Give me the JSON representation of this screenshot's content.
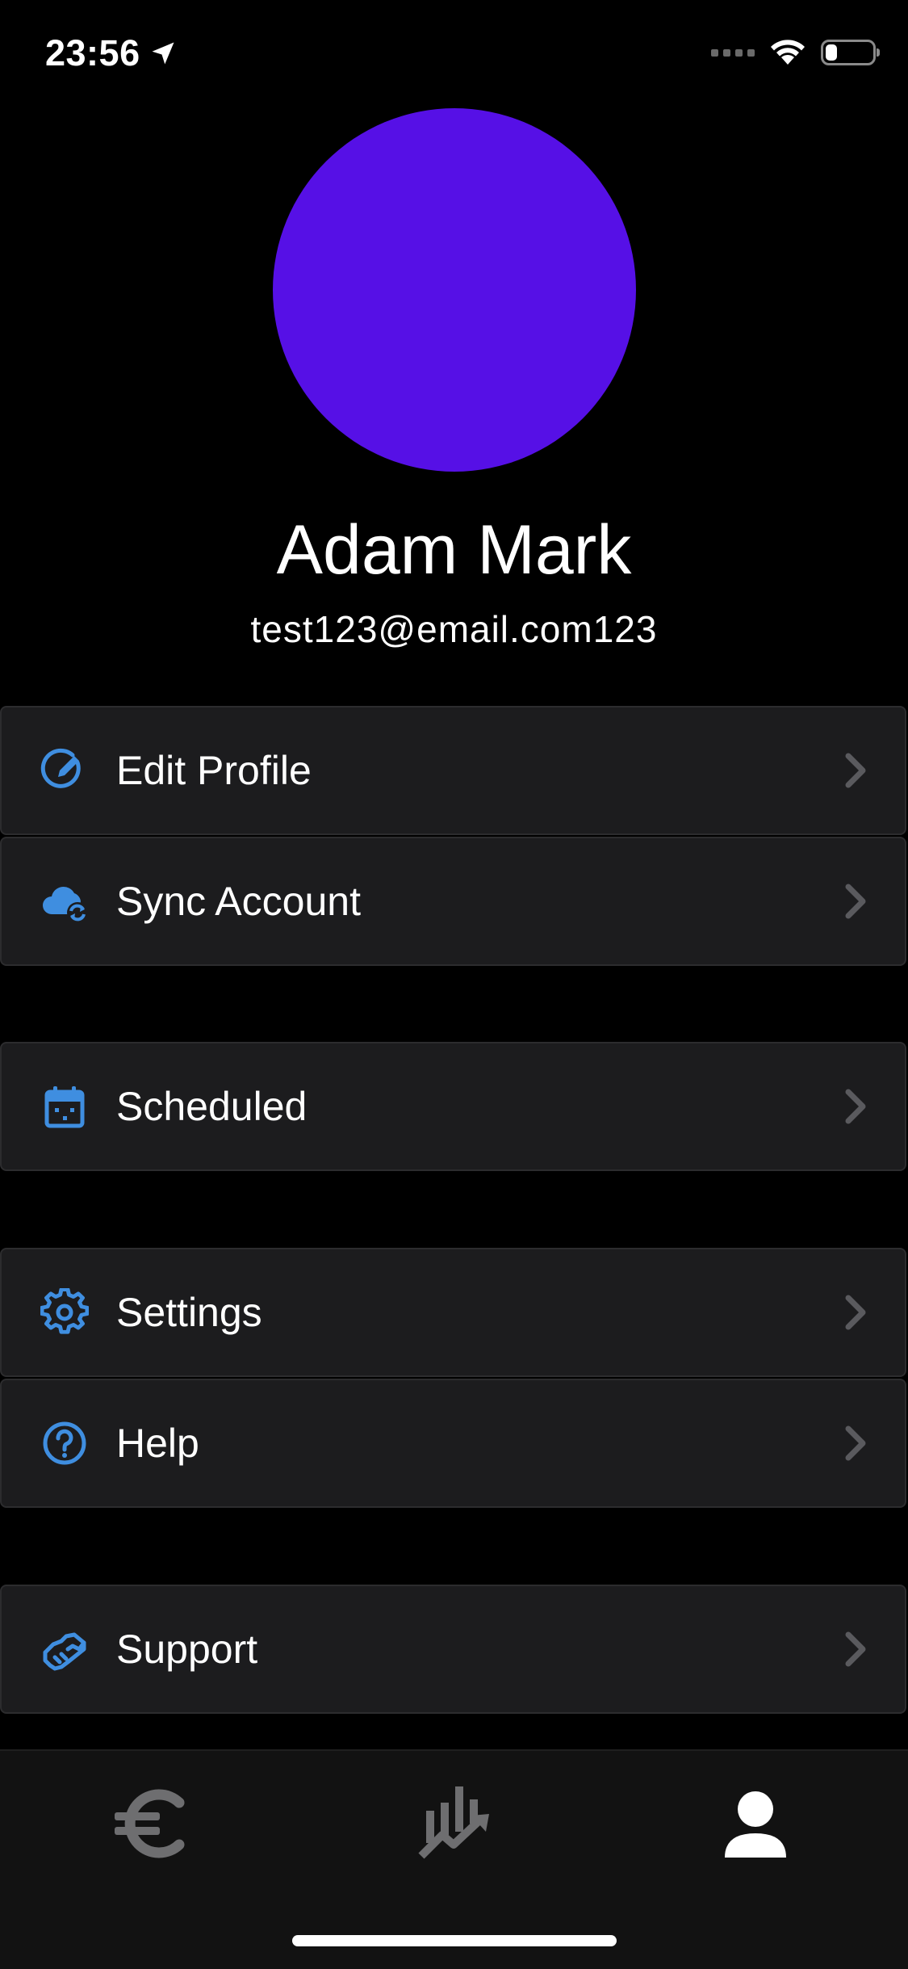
{
  "status_bar": {
    "time": "23:56",
    "battery_level": 0.25
  },
  "profile": {
    "name": "Adam Mark",
    "email": "test123@email.com123",
    "avatar_color": "#5610e6"
  },
  "theme": {
    "accent": "#3f8ee0",
    "chevron": "#5a5a5e",
    "row_bg": "#1c1c1e"
  },
  "menu": {
    "edit_profile": {
      "label": "Edit Profile",
      "icon": "edit-pencil-icon"
    },
    "sync_account": {
      "label": "Sync Account",
      "icon": "cloud-sync-icon"
    },
    "scheduled": {
      "label": "Scheduled",
      "icon": "calendar-icon"
    },
    "settings": {
      "label": "Settings",
      "icon": "gear-icon"
    },
    "help": {
      "label": "Help",
      "icon": "question-circle-icon"
    },
    "support": {
      "label": "Support",
      "icon": "handshake-icon"
    }
  },
  "tab_bar": {
    "tabs": [
      {
        "icon": "euro-icon",
        "active": false
      },
      {
        "icon": "chart-trend-icon",
        "active": false
      },
      {
        "icon": "user-icon",
        "active": true
      }
    ]
  }
}
